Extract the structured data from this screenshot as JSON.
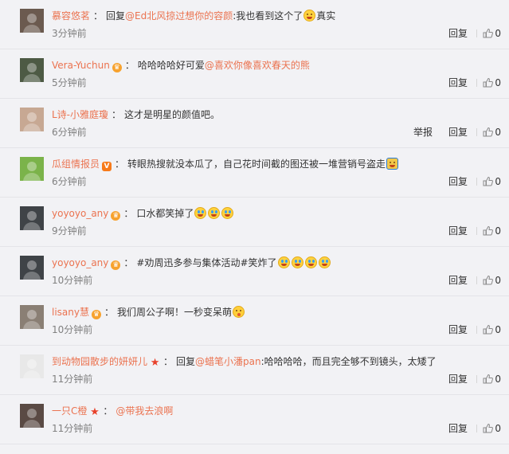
{
  "actions": {
    "reply": "回复",
    "report": "举报"
  },
  "comments": [
    {
      "user": "慕容悠茗",
      "badge": "",
      "prefix": "：",
      "reply_word": "回复",
      "mention": "@Ed北风掠过想你的容颜",
      "text": ":我也看到这个了",
      "emoji": [
        "laugh"
      ],
      "trail": "真实",
      "time": "3分钟前",
      "likes": "0",
      "report": false,
      "avatar_color": "#6b5a4f"
    },
    {
      "user": "Vera-Yuchun",
      "badge": "crown",
      "prefix": "：",
      "reply_word": "",
      "mention": "",
      "text": "哈哈哈哈好可爱",
      "mention2": "@喜欢你像喜欢春天的熊",
      "emoji": [],
      "trail": "",
      "time": "5分钟前",
      "likes": "0",
      "report": false,
      "avatar_color": "#4d5a44"
    },
    {
      "user": "L诗-小雅庭瓊",
      "badge": "",
      "prefix": "：",
      "reply_word": "",
      "mention": "",
      "text": "这才是明星的颜值吧。",
      "emoji": [],
      "trail": "",
      "time": "6分钟前",
      "likes": "0",
      "report": true,
      "avatar_color": "#c7a893"
    },
    {
      "user": "瓜组情报员",
      "badge": "v",
      "prefix": "：",
      "reply_word": "",
      "mention": "",
      "text": "转眼热搜就没本瓜了，自己花时间截的图还被一堆营销号盗走",
      "emoji": [
        "tree"
      ],
      "trail": "",
      "time": "6分钟前",
      "likes": "0",
      "report": false,
      "avatar_color": "#7bb34a"
    },
    {
      "user": "yoyoyo_any",
      "badge": "crown",
      "prefix": "：",
      "reply_word": "",
      "mention": "",
      "text": "口水都笑掉了",
      "emoji": [
        "cry",
        "cry",
        "cry"
      ],
      "trail": "",
      "time": "9分钟前",
      "likes": "0",
      "report": false,
      "avatar_color": "#3f4347"
    },
    {
      "user": "yoyoyo_any",
      "badge": "crown",
      "prefix": "：",
      "reply_word": "",
      "mention": "",
      "text": "#劝周迅多参与集体活动#笑炸了",
      "emoji": [
        "cry",
        "cry",
        "cry",
        "cry"
      ],
      "trail": "",
      "time": "10分钟前",
      "likes": "0",
      "report": false,
      "avatar_color": "#3f4347"
    },
    {
      "user": "lisany慧",
      "badge": "crown",
      "prefix": "：",
      "reply_word": "",
      "mention": "",
      "text": "我们周公子啊！一秒变呆萌",
      "emoji": [
        "cute"
      ],
      "trail": "",
      "time": "10分钟前",
      "likes": "0",
      "report": false,
      "avatar_color": "#8a7f74"
    },
    {
      "user": "到动物园散步的妍妍儿",
      "badge": "star",
      "prefix": "：",
      "reply_word": "回复",
      "mention": "@蜡笔小潘pan",
      "text": ":哈哈哈哈，而且完全够不到镜头，太矮了",
      "emoji": [],
      "trail": "",
      "time": "11分钟前",
      "likes": "0",
      "report": false,
      "avatar_color": "#e8e8e8"
    },
    {
      "user": "一只C橙",
      "badge": "star",
      "prefix": "：",
      "reply_word": "",
      "mention": "@带我去浪啊",
      "text": "",
      "emoji": [],
      "trail": "",
      "time": "11分钟前",
      "likes": "0",
      "report": false,
      "avatar_color": "#5a4a44"
    }
  ]
}
